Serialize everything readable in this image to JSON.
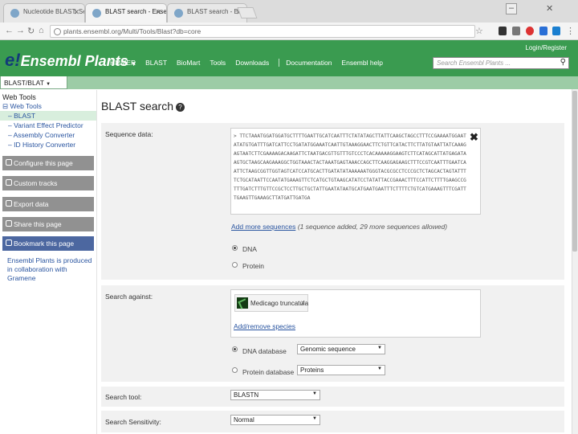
{
  "browser": {
    "tabs": [
      {
        "title": "Nucleotide BLAST: Sea",
        "active": false
      },
      {
        "title": "BLAST search - Ensembl",
        "active": true
      },
      {
        "title": "BLAST search - Ensembl",
        "active": false
      }
    ],
    "url": "plants.ensembl.org/Multi/Tools/Blast?db=core"
  },
  "header": {
    "logo_e": "e!",
    "logo_text": "Ensembl Plants",
    "login": "Login/Register",
    "nav": [
      "HMMER",
      "BLAST",
      "BioMart",
      "Tools",
      "Downloads",
      "Documentation",
      "Ensembl help"
    ],
    "search_placeholder": "Search Ensembl Plants ..."
  },
  "subtab": "BLAST/BLAT",
  "sidebar": {
    "heading": "Web Tools",
    "group": "Web Tools",
    "items": [
      {
        "label": "BLAST",
        "active": true
      },
      {
        "label": "Variant Effect Predictor",
        "active": false
      },
      {
        "label": "Assembly Converter",
        "active": false
      },
      {
        "label": "ID History Converter",
        "active": false
      }
    ],
    "buttons": [
      "Configure this page",
      "Custom tracks",
      "Export data",
      "Share this page",
      "Bookmark this page"
    ],
    "footer": "Ensembl Plants is produced in collaboration with Gramene"
  },
  "main": {
    "title": "BLAST search",
    "sequence": {
      "label": "Sequence data:",
      "text": ">\nTTCTAAATGGATGGATGCTTTTGAATTGCATCAATTTCTATATAGCTTATTCAAGCTAGCCTTTCCGAAAATGGAATATATGTGATTTGATCATTCCTGATATGGAAATCAATTGTAAAGGAACTTCTGTTCATACTTCTTATGTAATTATCAAAGAGTAATCTTCGAAAAGACAAGATTCTAATGACGTTGTTTGTCCCTCACAAAAAGGAAGTCTTCATAGCATTATGAGATAAGTGCTAAGCAAGAAAGGCTGGTAAACTACTAAATGAGTAAACCAGCTTCAAGGAGAAGCTTTCCGTCAATTTGAATCAATTCTAAGCGGTTGGTAGTCATCCATGCACTTGATATATAAAAAATGGGTACGCGCCTCCCGCTCTAGCACTAGTATTTTCTGCATAATTCCAATATGAAAGTTCTCATGCTGTAAGCATATCCTATATTACCGAAACTTTCCATTCTTTTGAAGCCGTTTGATCTTTGTTCCGCTCCTTGCTGCTATTGAATATAATGCATGAATGAATTTCTTTTCTGTCATGAAAGTTTCGATTTGAAGTTGAAAGCTTATGATTGATGA",
      "add_link": "Add more sequences",
      "add_note": "(1 sequence added, 29 more sequences allowed)",
      "types": [
        {
          "label": "DNA",
          "checked": true
        },
        {
          "label": "Protein",
          "checked": false
        }
      ]
    },
    "search_against": {
      "label": "Search against:",
      "species": "Medicago truncatula",
      "species_remove": "x",
      "add_link": "Add/remove species",
      "options": [
        {
          "label": "DNA database",
          "checked": true,
          "value": "Genomic sequence"
        },
        {
          "label": "Protein database",
          "checked": false,
          "value": "Proteins"
        }
      ]
    },
    "search_tool": {
      "label": "Search tool:",
      "value": "BLASTN"
    },
    "sensitivity": {
      "label": "Search Sensitivity:",
      "value": "Normal"
    }
  }
}
